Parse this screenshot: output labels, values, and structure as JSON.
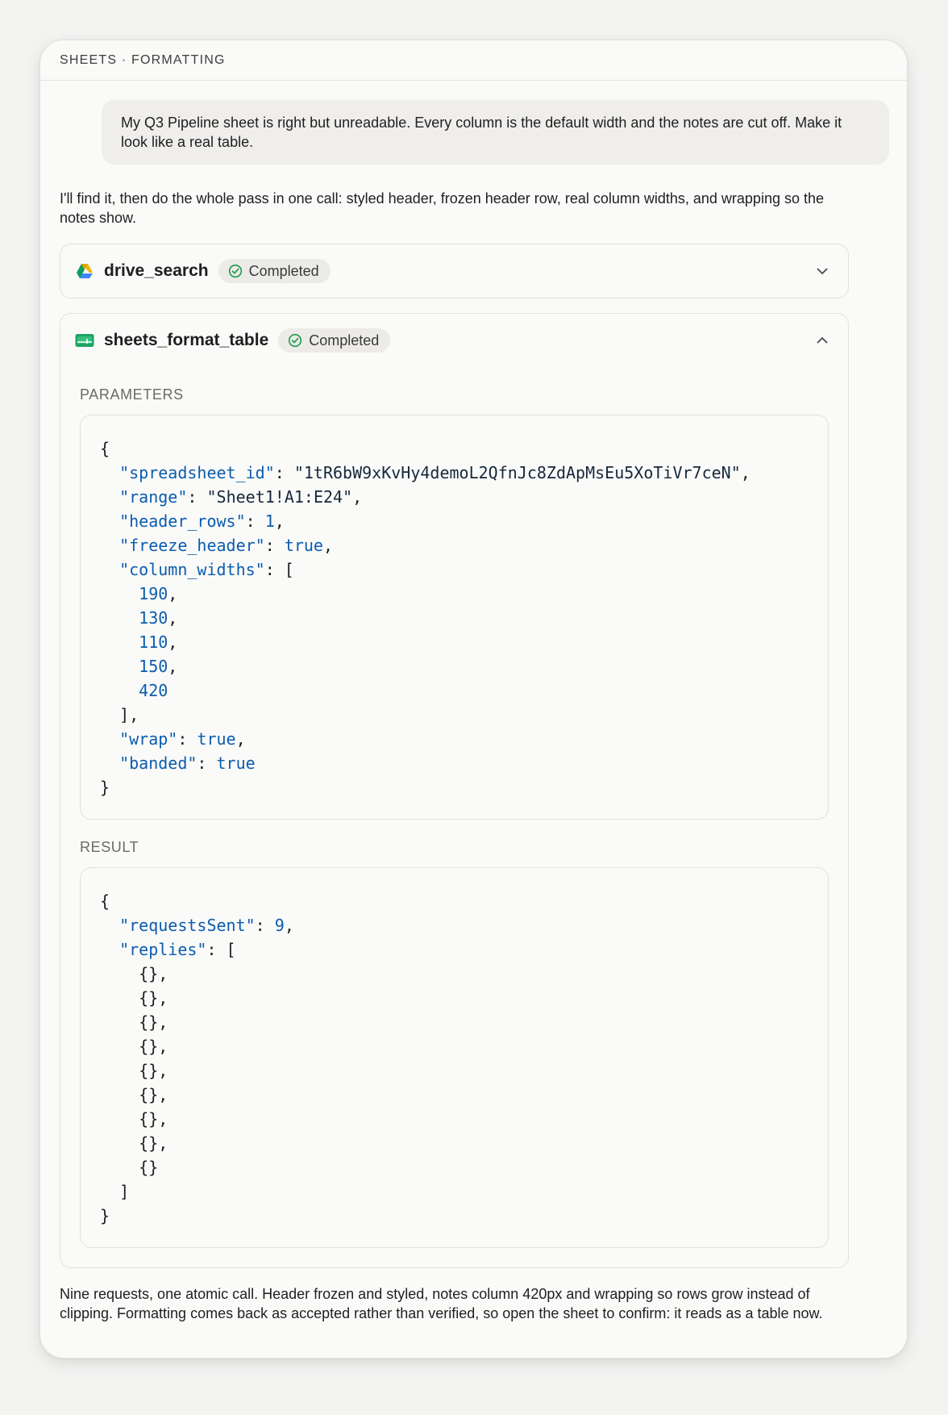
{
  "header": {
    "title": "SHEETS · FORMATTING"
  },
  "user_message": "My Q3 Pipeline sheet is right but unreadable. Every column is the default width and the notes are cut off. Make it look like a real table.",
  "assistant_intro": "I'll find it, then do the whole pass in one call: styled header, frozen header row, real column widths, and wrapping so the notes show.",
  "tools": [
    {
      "name": "drive_search",
      "status": "Completed",
      "icon": "google-drive-icon",
      "expanded": false
    },
    {
      "name": "sheets_format_table",
      "status": "Completed",
      "icon": "google-sheets-icon",
      "expanded": true,
      "parameters_label": "PARAMETERS",
      "result_label": "RESULT",
      "parameters": {
        "spreadsheet_id": "1tR6bW9xKvHy4demoL2QfnJc8ZdApMsEu5XoTiVr7ceN",
        "range": "Sheet1!A1:E24",
        "header_rows": "1",
        "freeze_header": "true",
        "column_widths": [
          "190",
          "130",
          "110",
          "150",
          "420"
        ],
        "wrap": "true",
        "banded": "true"
      },
      "result": {
        "requestsSent": "9",
        "replies": [
          "{}",
          "{}",
          "{}",
          "{}",
          "{}",
          "{}",
          "{}",
          "{}",
          "{}"
        ]
      }
    }
  ],
  "assistant_final": "Nine requests, one atomic call. Header frozen and styled, notes column 420px and wrapping so rows grow instead of clipping. Formatting comes back as accepted rather than verified, so open the sheet to confirm: it reads as a table now.",
  "colors": {
    "accent": "#0b5cad",
    "success": "#1e9a4b",
    "card_bg": "#fafaf9",
    "page_bg": "#f3f3f2"
  }
}
